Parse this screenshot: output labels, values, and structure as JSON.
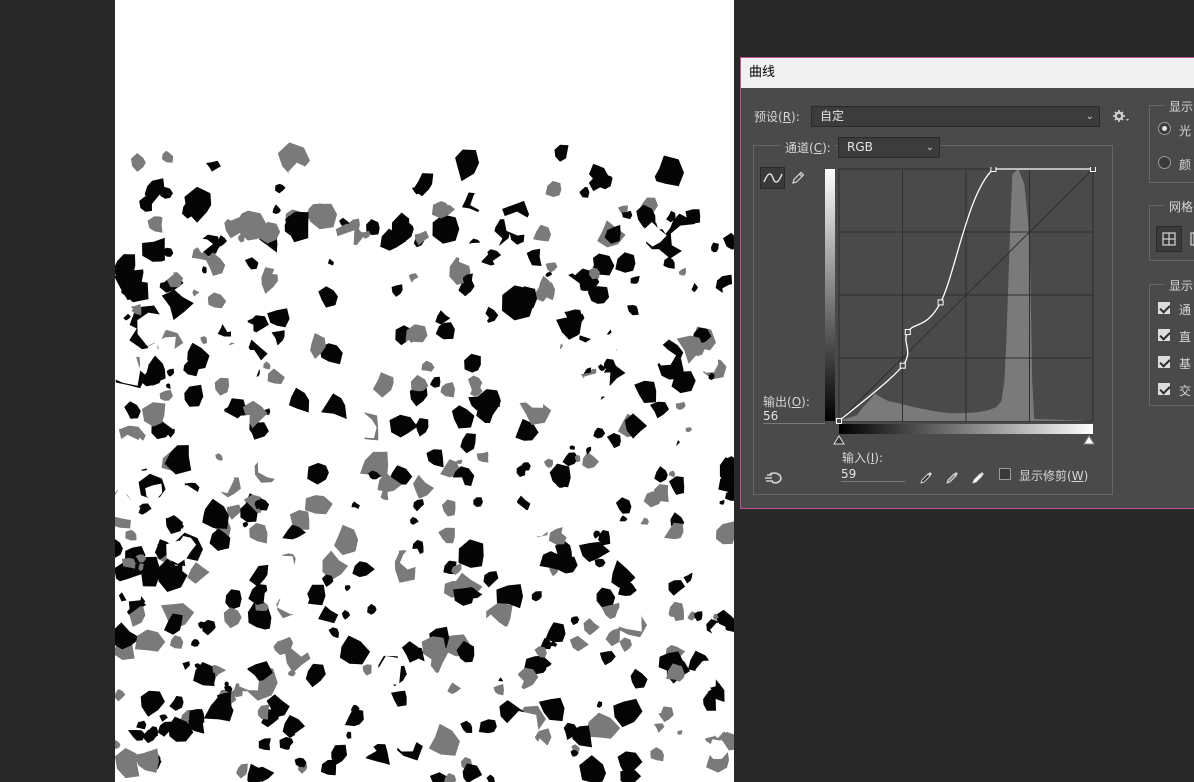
{
  "dialog": {
    "title": "曲线",
    "preset_label_pre": "预设(",
    "preset_label_key": "R",
    "preset_label_post": "):",
    "preset_value": "自定",
    "channel_label_pre": "通道(",
    "channel_label_key": "C",
    "channel_label_post": "):",
    "channel_value": "RGB",
    "output_label_pre": "输出(",
    "output_label_key": "O",
    "output_label_post": "):",
    "output_value": "56",
    "input_label_pre": "输入(",
    "input_label_key": "I",
    "input_label_post": "):",
    "input_value": "59",
    "show_clipping_pre": "显示修剪(",
    "show_clipping_key": "W",
    "show_clipping_post": ")"
  },
  "right_panel": {
    "display_header": "显示",
    "radio_light": "光",
    "radio_pigment": "颜",
    "grid_header": "网格",
    "show_header": "显示",
    "check_1": "通",
    "check_2": "直",
    "check_3": "基",
    "check_4": "交"
  },
  "curve_points_input_output": [
    [
      0,
      0
    ],
    [
      64,
      56
    ],
    [
      69,
      90
    ],
    [
      102,
      120
    ],
    [
      155,
      255
    ],
    [
      255,
      255
    ]
  ],
  "colors": {
    "dialog_bg": "#4a4a4a",
    "graph_bg": "#4a4a4a",
    "histogram": "#7a7a7a",
    "curve": "#ffffff",
    "dialog_border": "#c0509a"
  },
  "icons": {
    "curve_tool": "curve-tool-icon",
    "pencil_tool": "pencil-icon",
    "gear": "gear-icon",
    "auto": "auto-adjust-icon",
    "eyedroppers": [
      "black-eyedropper-icon",
      "gray-eyedropper-icon",
      "white-eyedropper-icon"
    ]
  }
}
